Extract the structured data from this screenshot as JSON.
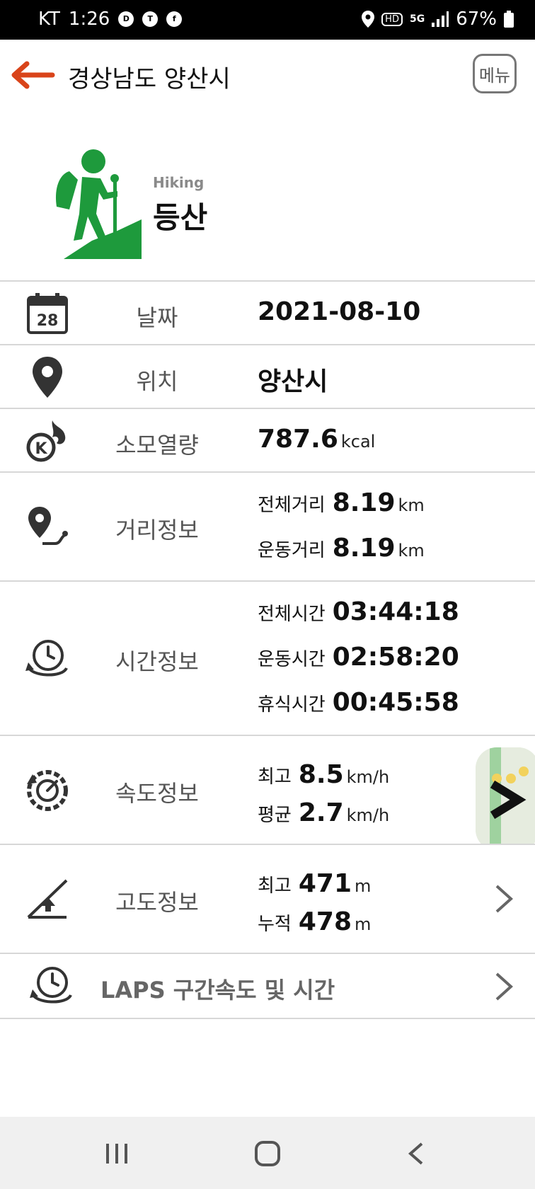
{
  "status_bar": {
    "carrier": "KT",
    "time": "1:26",
    "icons_left": [
      "d-app-icon",
      "talk-icon",
      "facebook-icon"
    ],
    "icons_right": [
      "location-icon",
      "hd-icon",
      "5g-icon",
      "signal-icon"
    ],
    "battery": "67%"
  },
  "header": {
    "title": "경상남도 양산시",
    "menu_label": "메뉴",
    "accent_color": "#d9441a"
  },
  "activity": {
    "en": "Hiking",
    "ko": "등산",
    "icon_color": "#1e9a3c"
  },
  "rows": {
    "date": {
      "label": "날짜",
      "value": "2021-08-10"
    },
    "location": {
      "label": "위치",
      "value": "양산시"
    },
    "calories": {
      "label": "소모열량",
      "value": "787.6",
      "unit": "kcal"
    },
    "distance": {
      "label": "거리정보",
      "total_label": "전체거리",
      "total_value": "8.19",
      "total_unit": "km",
      "move_label": "운동거리",
      "move_value": "8.19",
      "move_unit": "km"
    },
    "time": {
      "label": "시간정보",
      "total_label": "전체시간",
      "total_value": "03:44:18",
      "move_label": "운동시간",
      "move_value": "02:58:20",
      "rest_label": "휴식시간",
      "rest_value": "00:45:58"
    },
    "speed": {
      "label": "속도정보",
      "max_label": "최고",
      "max_value": "8.5",
      "max_unit": "km/h",
      "avg_label": "평균",
      "avg_value": "2.7",
      "avg_unit": "km/h"
    },
    "altitude": {
      "label": "고도정보",
      "max_label": "최고",
      "max_value": "471",
      "max_unit": "m",
      "cum_label": "누적",
      "cum_value": "478",
      "cum_unit": "m"
    },
    "laps": {
      "label": "LAPS 구간속도 및 시간"
    }
  }
}
